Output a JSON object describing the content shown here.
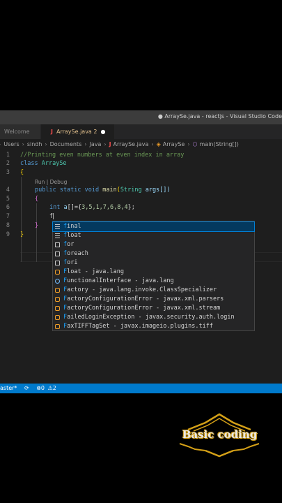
{
  "window": {
    "title": "● ArraySe.java - reactjs - Visual Studio Code"
  },
  "tabs": [
    {
      "label": "Welcome",
      "active": false
    },
    {
      "label": "ArraySe.java 2",
      "icon": "J",
      "active": true,
      "dirty_marker": "●"
    }
  ],
  "breadcrumb": [
    "Users",
    "sindh",
    "Documents",
    "Java",
    "ArraySe.java",
    "ArraySe",
    "main(String[])"
  ],
  "breadcrumb_icons": {
    "file": "J",
    "class": "class-icon",
    "method": "method-icon"
  },
  "editor": {
    "line_numbers": [
      "1",
      "2",
      "3",
      "4",
      "5",
      "6",
      "7",
      "8",
      "9"
    ],
    "lines": {
      "l1": "//Printing even numbers at even index in array",
      "l2_kw": "class",
      "l2_name": "ArraySe",
      "l3": "{",
      "codelens": "Run | Debug",
      "l4_kw": "public static void",
      "l4_fn": "main",
      "l4_type": "String",
      "l4_arg": "args[])",
      "l4_open": "(",
      "l5": "{",
      "l6_kw": "int",
      "l6_var": "a",
      "l6_rest": "[]={",
      "l6_nums": "3,5,1,7,6,8,4",
      "l6_end": "};",
      "l7": "f",
      "l8": "}",
      "l9": "}"
    }
  },
  "suggestions": [
    {
      "match": "f",
      "rest": "inal",
      "icon": "keyword",
      "selected": true
    },
    {
      "match": "f",
      "rest": "loat",
      "icon": "keyword",
      "selected": false
    },
    {
      "match": "f",
      "rest": "or",
      "icon": "snippet",
      "selected": false
    },
    {
      "match": "f",
      "rest": "oreach",
      "icon": "snippet",
      "selected": false
    },
    {
      "match": "f",
      "rest": "ori",
      "icon": "snippet",
      "selected": false
    },
    {
      "match": "F",
      "rest": "loat - java.lang",
      "icon": "class",
      "selected": false
    },
    {
      "match": "F",
      "rest": "unctionalInterface - java.lang",
      "icon": "interface",
      "selected": false
    },
    {
      "match": "F",
      "rest": "actory - java.lang.invoke.ClassSpecializer",
      "icon": "class",
      "selected": false
    },
    {
      "match": "F",
      "rest": "actoryConfigurationError - javax.xml.parsers",
      "icon": "class",
      "selected": false
    },
    {
      "match": "F",
      "rest": "actoryConfigurationError - javax.xml.stream",
      "icon": "class",
      "selected": false
    },
    {
      "match": "F",
      "rest": "ailedLoginException - javax.security.auth.login",
      "icon": "class",
      "selected": false
    },
    {
      "match": "F",
      "rest": "axTIFFTagSet - javax.imageio.plugins.tiff",
      "icon": "class",
      "selected": false
    }
  ],
  "statusbar": {
    "branch": "aster*",
    "errors": "0",
    "warnings": "2"
  },
  "watermark": {
    "text": "Basic coding",
    "color": "#d4a017"
  }
}
